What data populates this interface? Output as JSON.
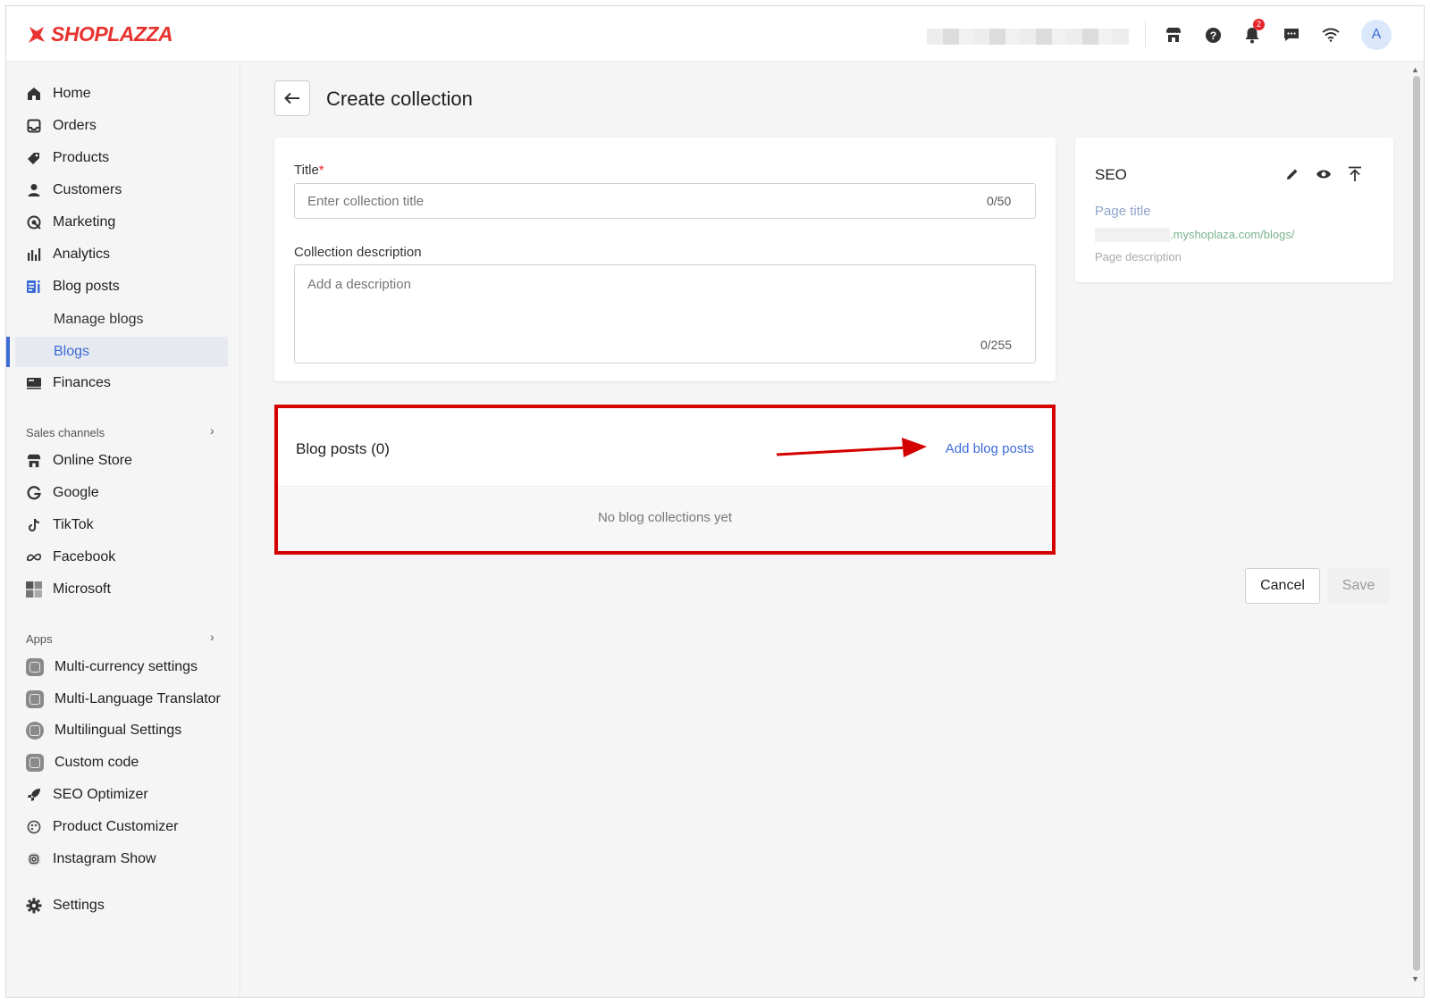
{
  "brand": {
    "name": "SHOPLAZZA",
    "color": "#e8322f"
  },
  "topbar": {
    "notifications_count": "2",
    "avatar_initial": "A",
    "icons": [
      "store-icon",
      "help-icon",
      "bell-icon",
      "chat-icon",
      "wifi-icon"
    ]
  },
  "sidebar": {
    "main_items": [
      {
        "label": "Home",
        "icon": "home-icon"
      },
      {
        "label": "Orders",
        "icon": "orders-icon"
      },
      {
        "label": "Products",
        "icon": "tag-icon"
      },
      {
        "label": "Customers",
        "icon": "person-icon"
      },
      {
        "label": "Marketing",
        "icon": "marketing-icon"
      },
      {
        "label": "Analytics",
        "icon": "analytics-icon"
      },
      {
        "label": "Blog posts",
        "icon": "blog-icon"
      }
    ],
    "blog_sub_items": [
      {
        "label": "Manage blogs"
      },
      {
        "label": "Blogs",
        "active": true
      }
    ],
    "finances": {
      "label": "Finances",
      "icon": "finances-icon"
    },
    "sales_channels_label": "Sales channels",
    "sales_channels": [
      {
        "label": "Online Store",
        "icon": "store-icon"
      },
      {
        "label": "Google",
        "icon": "google-icon"
      },
      {
        "label": "TikTok",
        "icon": "tiktok-icon"
      },
      {
        "label": "Facebook",
        "icon": "meta-icon"
      },
      {
        "label": "Microsoft",
        "icon": "microsoft-icon"
      }
    ],
    "apps_label": "Apps",
    "apps": [
      {
        "label": "Multi-currency settings",
        "icon": "currency-app-icon"
      },
      {
        "label": "Multi-Language Translator",
        "icon": "translator-app-icon"
      },
      {
        "label": "Multilingual Settings",
        "icon": "multilingual-app-icon"
      },
      {
        "label": "Custom code",
        "icon": "code-app-icon"
      },
      {
        "label": "SEO Optimizer",
        "icon": "rocket-icon"
      },
      {
        "label": "Product Customizer",
        "icon": "customizer-icon"
      },
      {
        "label": "Instagram Show",
        "icon": "instagram-icon"
      }
    ],
    "settings": {
      "label": "Settings",
      "icon": "gear-icon"
    }
  },
  "page": {
    "title": "Create collection",
    "title_field": {
      "label": "Title",
      "required_mark": "*",
      "placeholder": "Enter collection title",
      "counter": "0/50"
    },
    "description_field": {
      "label": "Collection description",
      "placeholder": "Add a description",
      "counter": "0/255"
    },
    "blog_posts": {
      "title": "Blog posts (0)",
      "add_link": "Add blog posts",
      "empty_text": "No blog collections yet"
    },
    "seo": {
      "title": "SEO",
      "page_title": "Page title",
      "url_suffix": ".myshoplaza.com/blogs/",
      "page_description": "Page description"
    },
    "actions": {
      "cancel": "Cancel",
      "save": "Save"
    }
  },
  "annotation": {
    "highlight_color": "#d40000"
  }
}
